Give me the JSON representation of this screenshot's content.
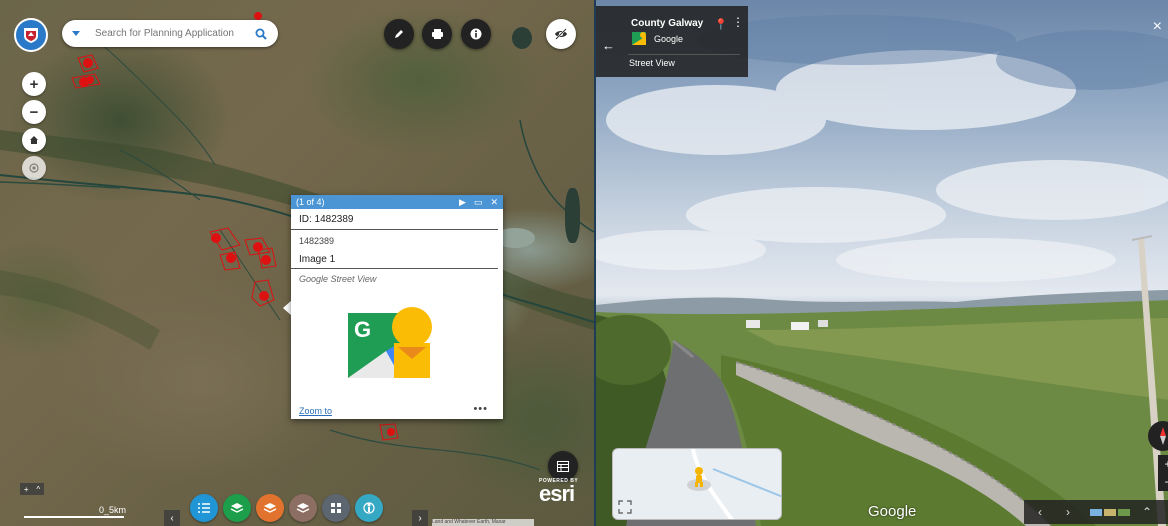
{
  "map": {
    "search_placeholder": "Search for Planning Application",
    "zoom_in": "+",
    "zoom_out": "−",
    "scale_text": "0_5km",
    "powered_by": "POWERED BY",
    "esri": "esri",
    "attribution": "Land and Whatever Earth, Maxar"
  },
  "popup": {
    "counter": "(1 of 4)",
    "title": "ID: 1482389",
    "id_value": "1482389",
    "image_title": "Image 1",
    "image_caption": "Google Street View",
    "zoom_link": "Zoom to",
    "more": "•••"
  },
  "street_view": {
    "place": "County Galway",
    "provider": "Google",
    "label": "Street View",
    "watermark": "Google",
    "close": "×"
  },
  "colors": {
    "popup_header": "#4b95d5",
    "toolbar": [
      "#2196d6",
      "#1c9e4a",
      "#e2732e",
      "#8d6e63",
      "#5b6670",
      "#35a9c4"
    ]
  },
  "icons": [
    "logo-icon",
    "dropdown-icon",
    "search-icon",
    "edit-icon",
    "print-icon",
    "info-icon",
    "hide-icon",
    "zoom-in-icon",
    "zoom-out-icon",
    "home-icon",
    "locate-icon",
    "list-icon",
    "layers-icon",
    "layers2-icon",
    "layers3-icon",
    "grid-icon",
    "streetview-icon",
    "table-icon"
  ]
}
